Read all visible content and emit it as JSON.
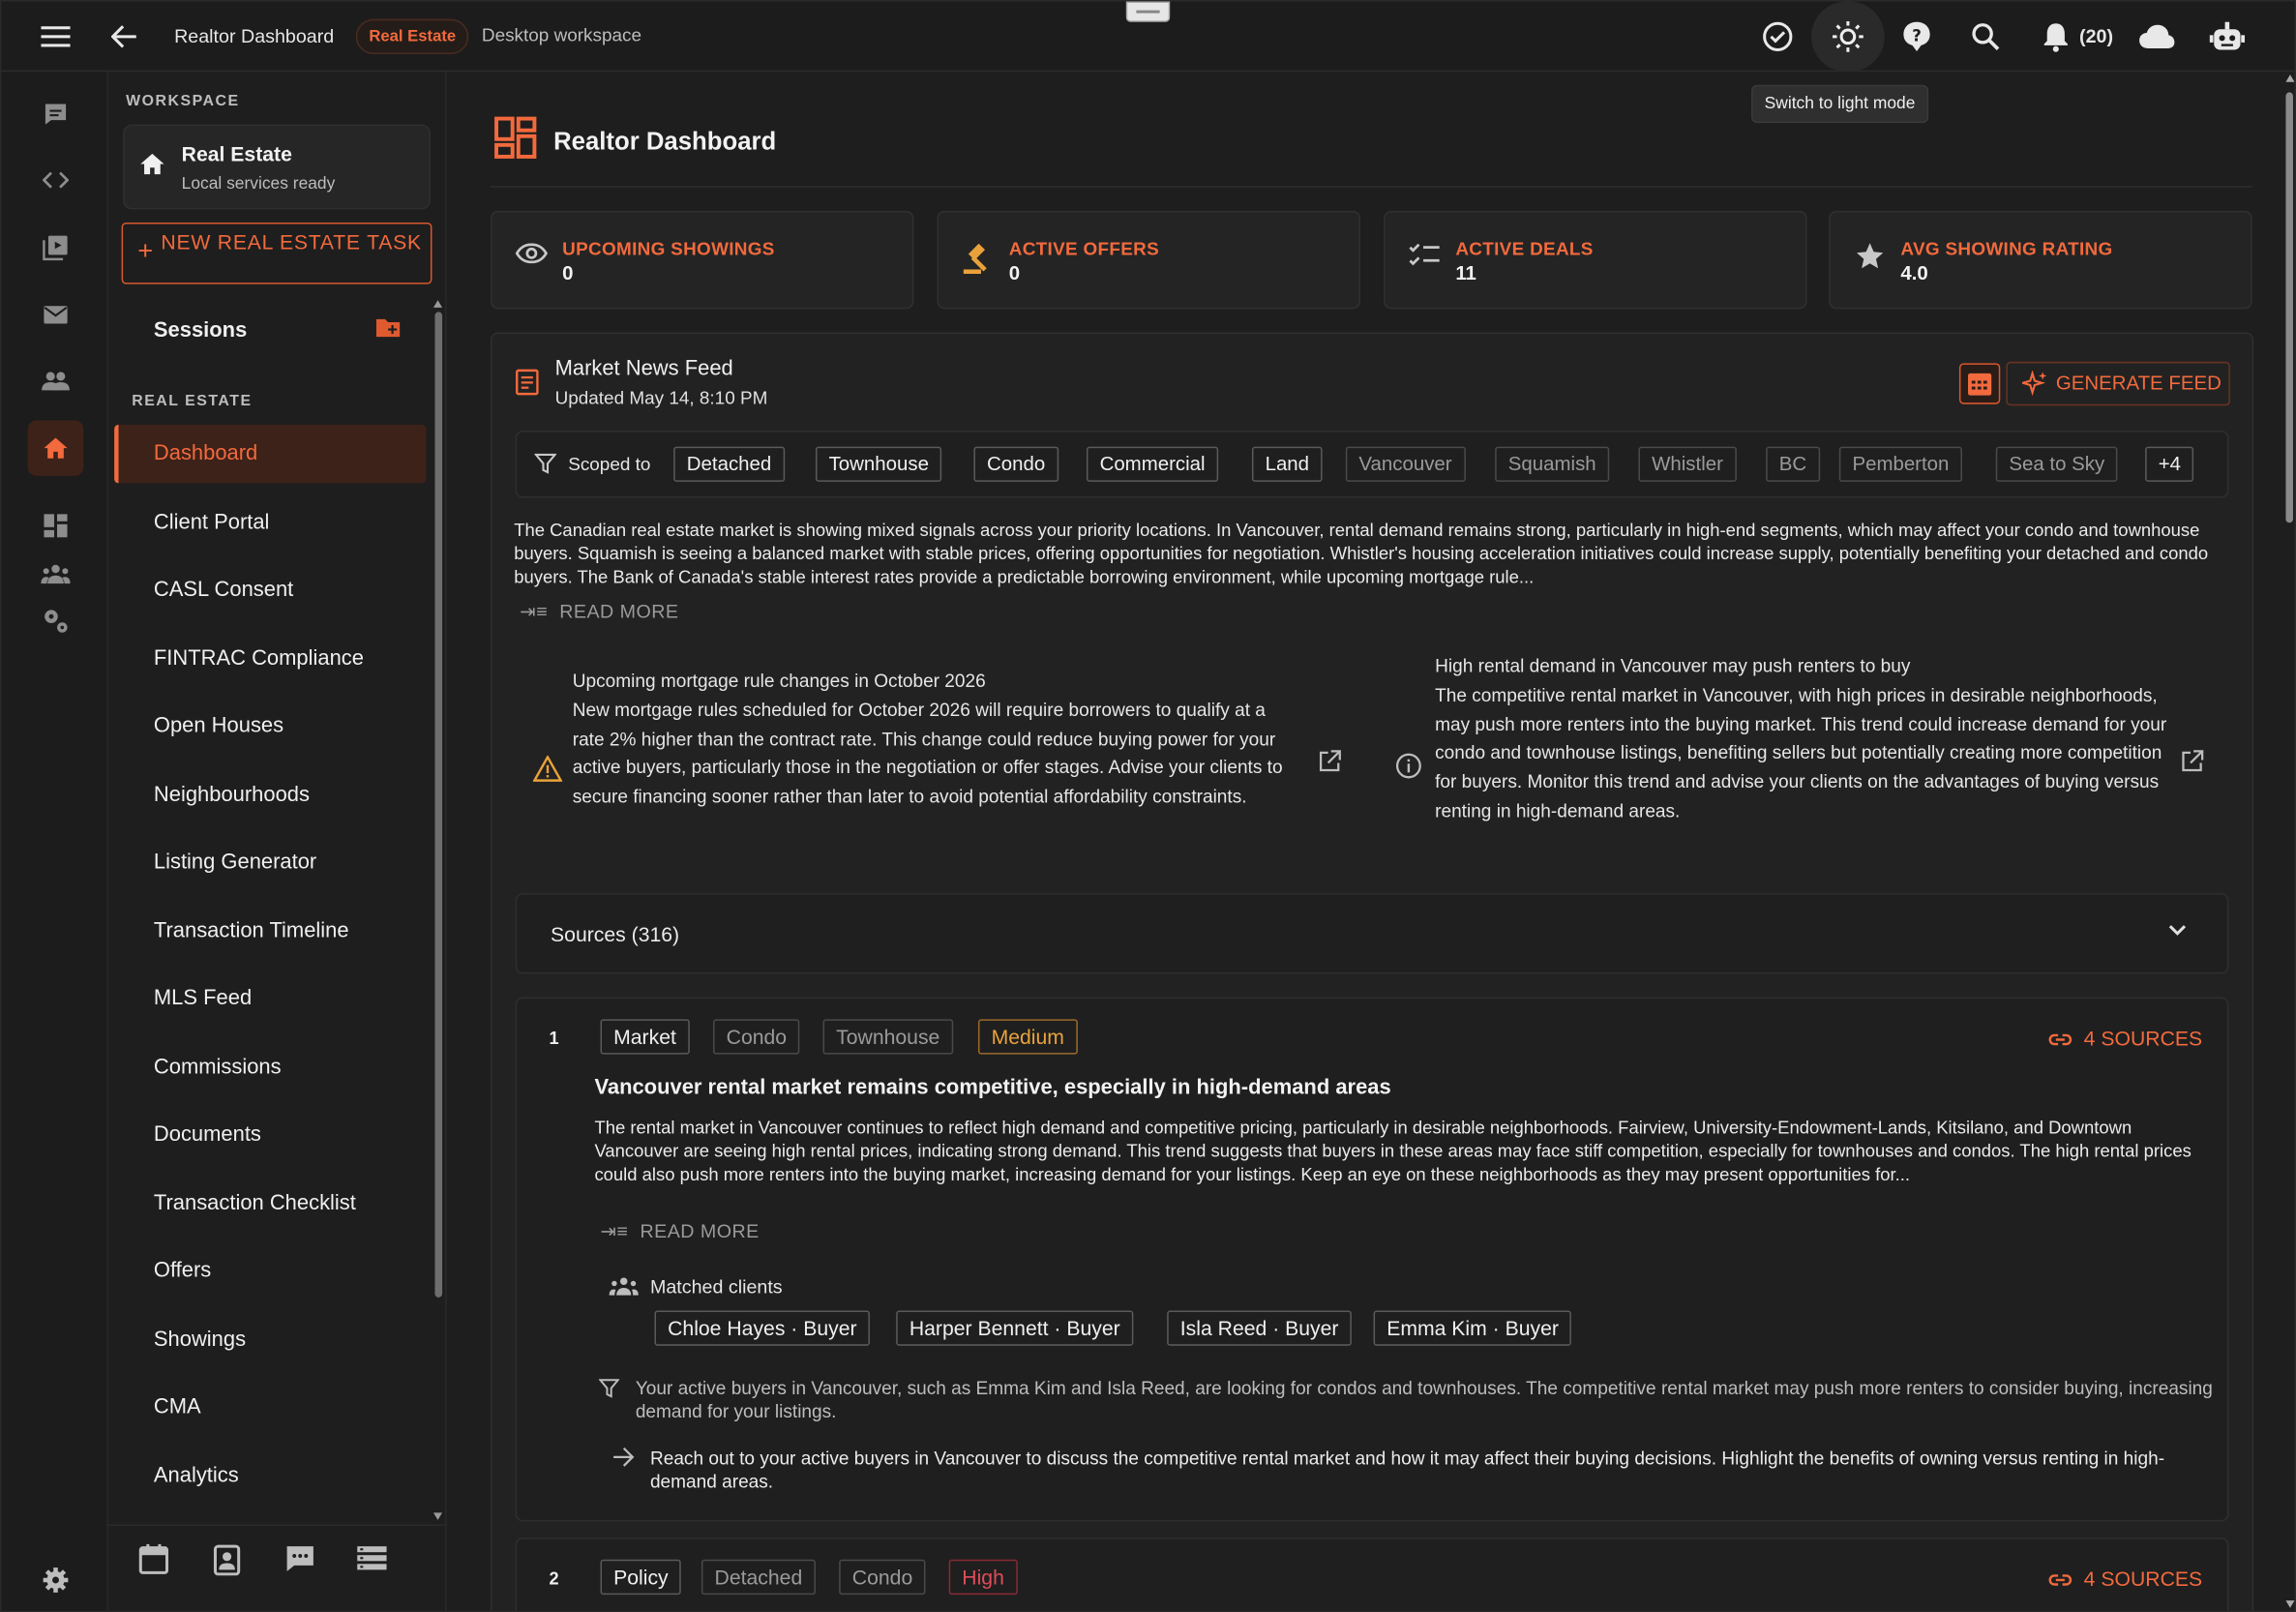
{
  "topbar": {
    "title": "Realtor Dashboard",
    "workspace_chip": "Real Estate",
    "workspace_desc": "Desktop workspace",
    "notifications_count": "(20)",
    "tooltip": "Switch to light mode"
  },
  "sidebar": {
    "workspace_label": "WORKSPACE",
    "workspace_name": "Real Estate",
    "workspace_status": "Local services ready",
    "new_task_label": "NEW REAL ESTATE TASK",
    "sessions_label": "Sessions",
    "section_label": "REAL ESTATE",
    "items": [
      {
        "label": "Dashboard",
        "active": true
      },
      {
        "label": "Client Portal"
      },
      {
        "label": "CASL Consent"
      },
      {
        "label": "FINTRAC Compliance"
      },
      {
        "label": "Open Houses"
      },
      {
        "label": "Neighbourhoods"
      },
      {
        "label": "Listing Generator"
      },
      {
        "label": "Transaction Timeline"
      },
      {
        "label": "MLS Feed"
      },
      {
        "label": "Commissions"
      },
      {
        "label": "Documents"
      },
      {
        "label": "Transaction Checklist"
      },
      {
        "label": "Offers"
      },
      {
        "label": "Showings"
      },
      {
        "label": "CMA"
      },
      {
        "label": "Analytics"
      }
    ]
  },
  "page": {
    "title": "Realtor Dashboard"
  },
  "stats": [
    {
      "label": "UPCOMING SHOWINGS",
      "value": "0",
      "icon": "eye-icon"
    },
    {
      "label": "ACTIVE OFFERS",
      "value": "0",
      "icon": "gavel-icon"
    },
    {
      "label": "ACTIVE DEALS",
      "value": "11",
      "icon": "checklist-icon"
    },
    {
      "label": "AVG SHOWING RATING",
      "value": "4.0",
      "icon": "star-icon"
    }
  ],
  "feed": {
    "title": "Market News Feed",
    "updated": "Updated May 14, 8:10 PM",
    "generate_label": "GENERATE FEED",
    "scope_label": "Scoped to",
    "scope_chips": [
      "Detached",
      "Townhouse",
      "Condo",
      "Commercial",
      "Land"
    ],
    "location_chips": [
      "Vancouver",
      "Squamish",
      "Whistler",
      "BC",
      "Pemberton",
      "Sea to Sky"
    ],
    "more_chip": "+4",
    "summary": "The Canadian real estate market is showing mixed signals across your priority locations. In Vancouver, rental demand remains strong, particularly in high-end segments, which may affect your condo and townhouse buyers. Squamish is seeing a balanced market with stable prices, offering opportunities for negotiation. Whistler's housing acceleration initiatives could increase supply, potentially benefiting your detached and condo buyers. The Bank of Canada's stable interest rates provide a predictable borrowing environment, while upcoming mortgage rule...",
    "read_more": "READ MORE",
    "alerts": [
      {
        "title": "Upcoming mortgage rule changes in October 2026",
        "body": "New mortgage rules scheduled for October 2026 will require borrowers to qualify at a rate 2% higher than the contract rate. This change could reduce buying power for your active buyers, particularly those in the negotiation or offer stages. Advise your clients to secure financing sooner rather than later to avoid potential affordability constraints."
      },
      {
        "title": "High rental demand in Vancouver may push renters to buy",
        "body": "The competitive rental market in Vancouver, with high prices in desirable neighborhoods, may push more renters into the buying market. This trend could increase demand for your condo and townhouse listings, benefiting sellers but potentially creating more competition for buyers. Monitor this trend and advise your clients on the advantages of buying versus renting in high-demand areas."
      }
    ],
    "sources_label": "Sources (316)",
    "news": [
      {
        "num": "1",
        "tags": [
          "Market",
          "Condo",
          "Townhouse",
          "Medium"
        ],
        "sources": "4 SOURCES",
        "headline": "Vancouver rental market remains competitive, especially in high-demand areas",
        "body": "The rental market in Vancouver continues to reflect high demand and competitive pricing, particularly in desirable neighborhoods. Fairview, University-Endowment-Lands, Kitsilano, and Downtown Vancouver are seeing high rental prices, indicating strong demand. This trend suggests that buyers in these areas may face stiff competition, especially for townhouses and condos. The high rental prices could also push more renters into the buying market, increasing demand for your listings. Keep an eye on these neighborhoods as they may present opportunities for...",
        "read_more": "READ MORE",
        "matched_label": "Matched clients",
        "clients": [
          "Chloe Hayes · Buyer",
          "Harper Bennett · Buyer",
          "Isla Reed · Buyer",
          "Emma Kim · Buyer"
        ],
        "insight": "Your active buyers in Vancouver, such as Emma Kim and Isla Reed, are looking for condos and townhouses. The competitive rental market may push more renters to consider buying, increasing demand for your listings.",
        "action": "Reach out to your active buyers in Vancouver to discuss the competitive rental market and how it may affect their buying decisions. Highlight the benefits of owning versus renting in high-demand areas."
      },
      {
        "num": "2",
        "tags": [
          "Policy",
          "Detached",
          "Condo",
          "High"
        ],
        "sources": "4 SOURCES"
      }
    ]
  },
  "colors": {
    "accent": "#f26a3d",
    "background": "#1e1e1e",
    "medium": "#e9a23b",
    "high": "#e04c5a"
  }
}
